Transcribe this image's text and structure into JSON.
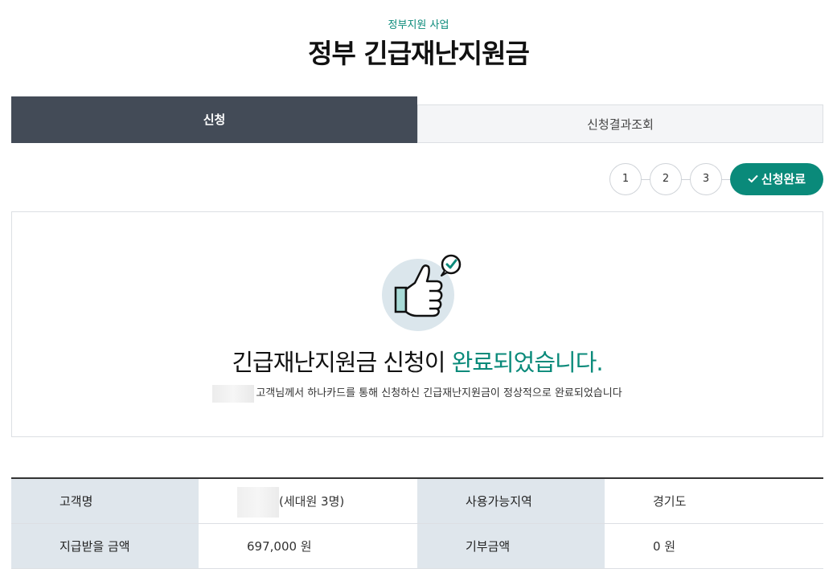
{
  "header": {
    "subtitle": "정부지원 사업",
    "title": "정부 긴급재난지원금"
  },
  "tabs": [
    {
      "label": "신청",
      "active": true
    },
    {
      "label": "신청결과조회",
      "active": false
    }
  ],
  "steps": {
    "items": [
      "1",
      "2",
      "3"
    ],
    "done_label": "신청완료"
  },
  "result": {
    "headline_main": "긴급재난지원금 신청이 ",
    "headline_accent": "완료되었습니다.",
    "description": "고객님께서 하나카드를 통해 신청하신 긴급재난지원금이 정상적으로 완료되었습니다"
  },
  "info": {
    "customer_label": "고객명",
    "customer_value": "(세대원 3명)",
    "region_label": "사용가능지역",
    "region_value": "경기도",
    "amount_label": "지급받을 금액",
    "amount_value": "697,000 원",
    "donation_label": "기부금액",
    "donation_value": "0 원"
  },
  "colors": {
    "accent": "#0a8a7a",
    "tab_active": "#434b57",
    "table_header": "#dfe6ec"
  }
}
